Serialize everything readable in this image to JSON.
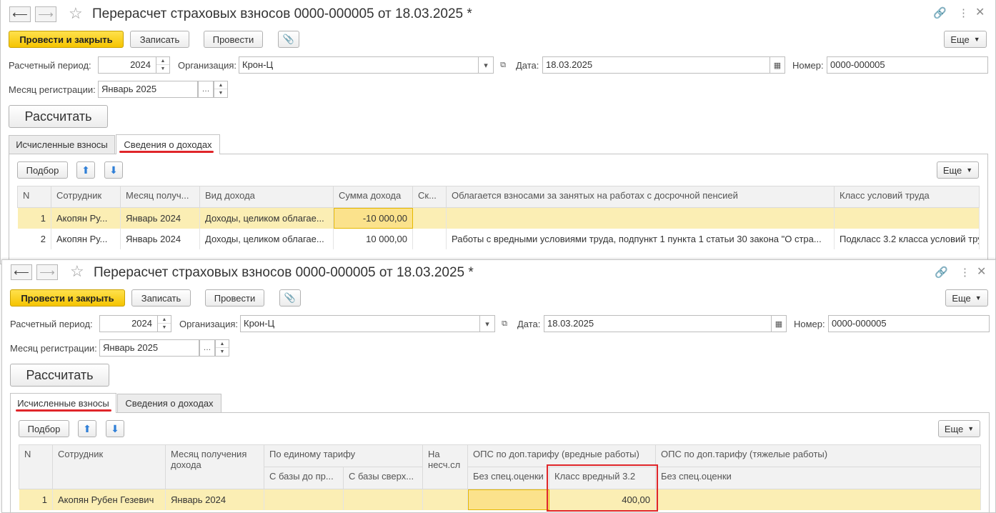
{
  "doc": {
    "title": "Перерасчет страховых взносов 0000-000005 от 18.03.2025 *",
    "buttons": {
      "post_close": "Провести и закрыть",
      "save": "Записать",
      "post": "Провести",
      "more": "Еще",
      "calculate": "Рассчитать",
      "select": "Подбор"
    },
    "labels": {
      "period": "Расчетный период:",
      "org": "Организация:",
      "date": "Дата:",
      "number": "Номер:",
      "reg_month": "Месяц регистрации:"
    },
    "values": {
      "period": "2024",
      "org": "Крон-Ц",
      "date": "18.03.2025",
      "number": "0000-000005",
      "reg_month": "Январь 2025"
    },
    "tabs": {
      "calculated": "Исчисленные взносы",
      "income": "Сведения о доходах"
    }
  },
  "income_table": {
    "headers": [
      "N",
      "Сотрудник",
      "Месяц получ...",
      "Вид дохода",
      "Сумма дохода",
      "Ск...",
      "Облагается взносами за занятых на работах с досрочной пенсией",
      "Класс условий труда"
    ],
    "rows": [
      [
        "1",
        "Акопян Ру...",
        "Январь 2024",
        "Доходы, целиком облагае...",
        "-10 000,00",
        "",
        "",
        ""
      ],
      [
        "2",
        "Акопян Ру...",
        "Январь 2024",
        "Доходы, целиком облагае...",
        "10 000,00",
        "",
        "Работы с вредными условиями труда, подпункт 1 пункта 1 статьи 30 закона \"О стра...",
        "Подкласс 3.2 класса условий тру"
      ]
    ]
  },
  "contrib_table": {
    "headers": {
      "n": "N",
      "employee": "Сотрудник",
      "month": "Месяц получения дохода",
      "single_tariff": "По единому тарифу",
      "base_to": "С базы до пр...",
      "base_over": "С базы сверх...",
      "accident": "На несч.сл",
      "ops_harmful": "ОПС по доп.тарифу (вредные работы)",
      "no_spec": "Без спец.оценки",
      "class_32": "Класс вредный 3.2",
      "ops_heavy": "ОПС по доп.тарифу (тяжелые работы)",
      "no_spec2": "Без спец.оценки"
    },
    "rows": [
      [
        "1",
        "Акопян Рубен Гезевич",
        "Январь 2024",
        "",
        "",
        "",
        "",
        "400,00",
        ""
      ]
    ]
  },
  "colors": {
    "primary_button": "#f5c400",
    "selected_row": "#fbeeb4",
    "highlight": "#e0262a"
  }
}
